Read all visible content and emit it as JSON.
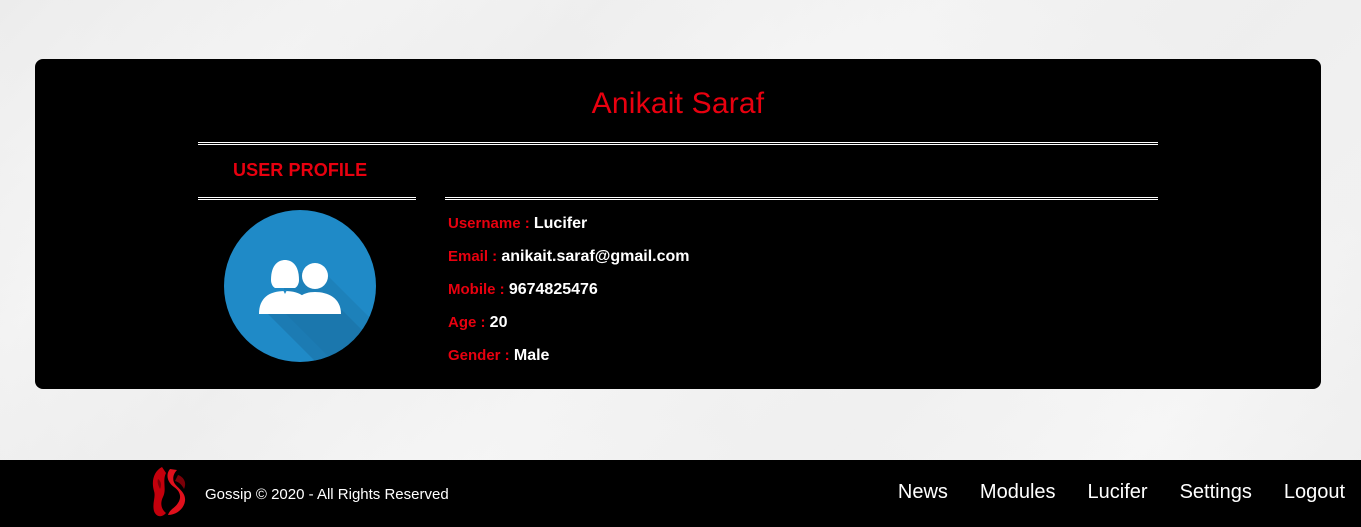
{
  "theme": {
    "accent": "#e8000f",
    "card_bg": "#000000",
    "avatar_bg": "#1f8ac7",
    "text_light": "#ffffff"
  },
  "profile": {
    "name": "Anikait Saraf",
    "section_title": "USER PROFILE",
    "avatar_icon": "users-icon",
    "fields": [
      {
        "label": "Username : ",
        "value": "Lucifer"
      },
      {
        "label": "Email : ",
        "value": "anikait.saraf@gmail.com"
      },
      {
        "label": "Mobile : ",
        "value": "9674825476"
      },
      {
        "label": "Age : ",
        "value": "20"
      },
      {
        "label": "Gender : ",
        "value": "Male"
      }
    ]
  },
  "footer": {
    "logo_icon": "gossip-logo-icon",
    "copyright": "Gossip © 2020 - All Rights Reserved",
    "nav": [
      {
        "label": "News"
      },
      {
        "label": "Modules"
      },
      {
        "label": "Lucifer"
      },
      {
        "label": "Settings"
      },
      {
        "label": "Logout"
      }
    ]
  }
}
